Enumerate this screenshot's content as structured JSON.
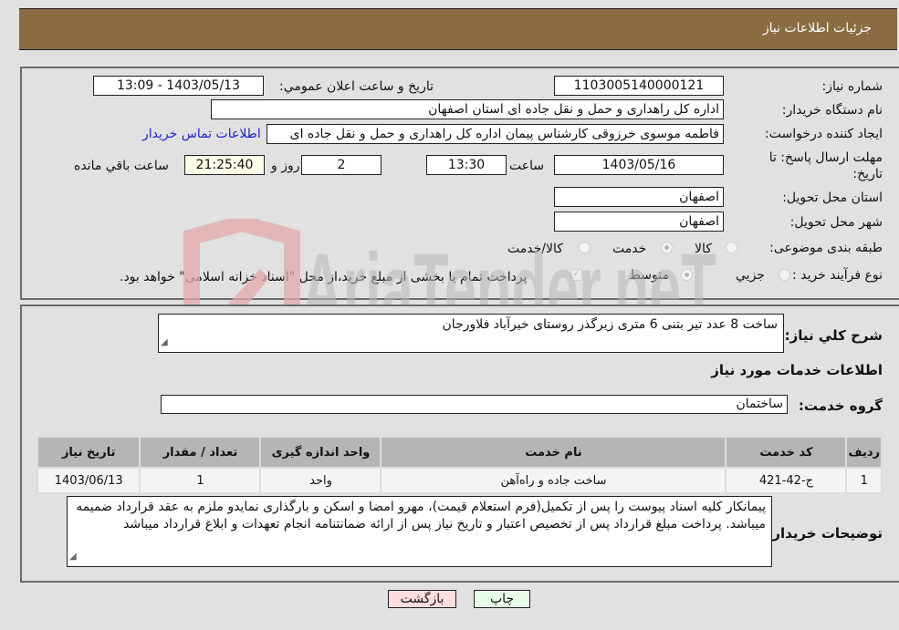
{
  "header": {
    "title": "جزئیات اطلاعات نیاز"
  },
  "form": {
    "need_number": {
      "label": "شماره نیاز:",
      "value": "1103005140000121"
    },
    "announce_datetime": {
      "label": "تاریخ و ساعت اعلان عمومي:",
      "value": "1403/05/13 - 13:09"
    },
    "buyer_org": {
      "label": "نام دستگاه خریدار:",
      "value": "اداره کل راهداری و حمل و نقل جاده ای استان اصفهان"
    },
    "requester": {
      "label": "ایجاد کننده درخواست:",
      "value": "فاطمه موسوی خرزوقی کارشناس پیمان اداره کل راهداری و حمل و نقل جاده ای",
      "contact_link": "اطلاعات تماس خریدار"
    },
    "deadline": {
      "label_line1": "مهلت ارسال پاسخ: تا",
      "label_line2": "تاریخ:",
      "date": "1403/05/16",
      "time_label": "ساعت",
      "time": "13:30",
      "days": "2",
      "days_label": "روز و",
      "remaining": "21:25:40",
      "remaining_label": "ساعت باقي مانده"
    },
    "province": {
      "label": "استان محل تحویل:",
      "value": "اصفهان"
    },
    "city": {
      "label": "شهر محل تحویل:",
      "value": "اصفهان"
    },
    "category": {
      "label": "طبقه بندی موضوعی:",
      "options": [
        {
          "label": "کالا",
          "checked": false
        },
        {
          "label": "خدمت",
          "checked": true
        },
        {
          "label": "کالا/خدمت",
          "checked": false
        }
      ]
    },
    "purchase_type": {
      "label": "نوع فرآیند خرید :",
      "options": [
        {
          "label": "جزيي",
          "checked": false
        },
        {
          "label": "متوسط",
          "checked": true
        }
      ],
      "treasury_note": "پرداخت تمام یا بخشی از مبلغ خرید،از محل \"اسناد خزانه اسلامی\" خواهد بود.",
      "treasury_checked": true
    }
  },
  "details": {
    "summary_label": "شرح کلي نياز:",
    "summary_value": "ساخت 8 عدد تیر بتنی 6 متری زیرگذر روستای خیرآباد فلاورجان",
    "services_heading": "اطلاعات خدمات مورد نیاز",
    "service_group_label": "گروه خدمت:",
    "service_group_value": "ساختمان",
    "table": {
      "headers": [
        "ردیف",
        "کد خدمت",
        "نام خدمت",
        "واحد اندازه گیری",
        "تعداد / مقدار",
        "تاریخ نیاز"
      ],
      "rows": [
        [
          "1",
          "ج-42-421",
          "ساخت جاده و راه‌آهن",
          "واحد",
          "1",
          "1403/06/13"
        ]
      ]
    },
    "buyer_notes_label": "توضیحات خریدار:",
    "buyer_notes_value": "پیمانکار کلیه اسناد پیوست را پس از تکمیل(فرم استعلام قیمت)، مهرو امضا و اسکن و بارگذاری نمایدو ملزم به عقد قرارداد ضمیمه میباشد. پرداخت مبلغ قرارداد پس از تخصیص اعتبار و تاریخ نیاز پس از ارائه ضمانتنامه انجام تعهدات و ابلاغ قرارداد میباشد"
  },
  "buttons": {
    "print": "چاپ",
    "back": "بازگشت"
  },
  "watermark": {
    "text": "AriaTender.neT"
  },
  "colors": {
    "header_bg": "#8b6c42",
    "link": "#2121c9",
    "back_btn": "#fddede",
    "print_btn": "#e7fde7",
    "remaining_bg": "#fdfde8"
  }
}
